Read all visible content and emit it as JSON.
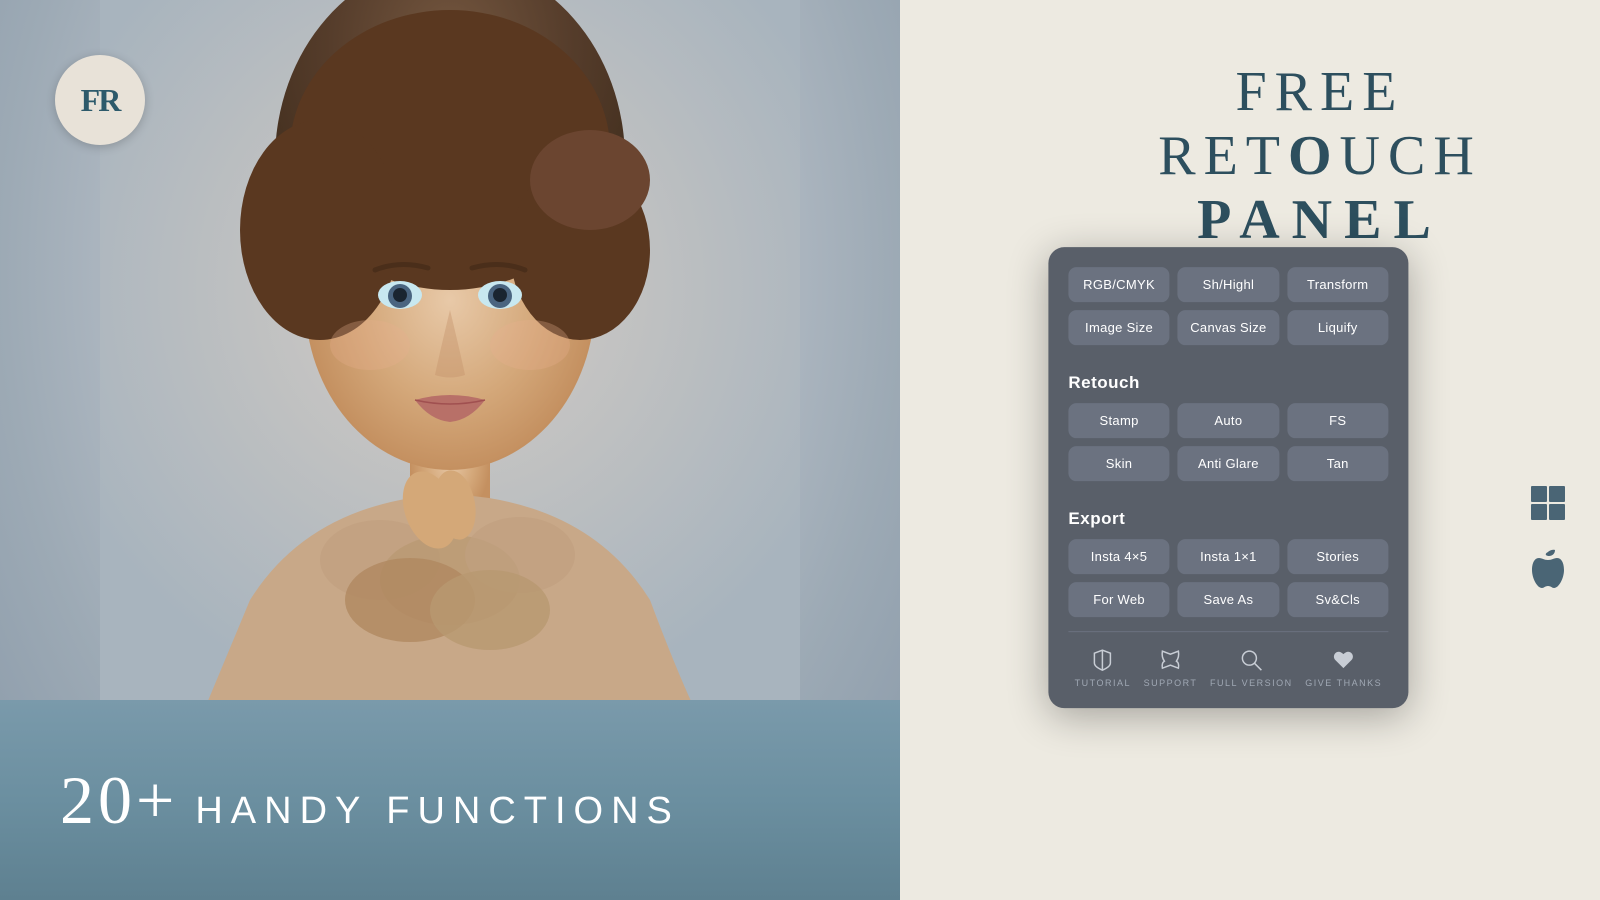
{
  "logo": {
    "text": "FR"
  },
  "hero": {
    "tagline_number": "20+",
    "tagline_text": "HANDY FUNCTIONS"
  },
  "title": {
    "line1_prefix": "FREE RET",
    "line1_bold": "O",
    "line1_suffix": "UCH",
    "line2": "PANEL"
  },
  "panel": {
    "top_buttons": [
      {
        "label": "RGB/CMYK"
      },
      {
        "label": "Sh/Highl"
      },
      {
        "label": "Transform"
      }
    ],
    "top_buttons2": [
      {
        "label": "Image Size"
      },
      {
        "label": "Canvas Size"
      },
      {
        "label": "Liquify"
      }
    ],
    "retouch_section": "Retouch",
    "retouch_buttons1": [
      {
        "label": "Stamp"
      },
      {
        "label": "Auto"
      },
      {
        "label": "FS"
      }
    ],
    "retouch_buttons2": [
      {
        "label": "Skin"
      },
      {
        "label": "Anti Glare"
      },
      {
        "label": "Tan"
      }
    ],
    "export_section": "Export",
    "export_buttons1": [
      {
        "label": "Insta 4×5"
      },
      {
        "label": "Insta 1×1"
      },
      {
        "label": "Stories"
      }
    ],
    "export_buttons2": [
      {
        "label": "For Web"
      },
      {
        "label": "Save As"
      },
      {
        "label": "Sv&Cls"
      }
    ],
    "toolbar": [
      {
        "icon": "✏️",
        "label": "TUTORIAL",
        "unicode": "✎"
      },
      {
        "icon": "🖌️",
        "label": "SUPPORT",
        "unicode": "✓"
      },
      {
        "icon": "🔍",
        "label": "FULL VERSION",
        "unicode": "⚲"
      },
      {
        "icon": "📋",
        "label": "GIVE THANKS",
        "unicode": "♥"
      }
    ]
  },
  "platforms": {
    "windows": "⊞",
    "apple": ""
  },
  "colors": {
    "panel_bg": "#595f69",
    "btn_bg": "#6b7280",
    "text_primary": "#2d4f5e",
    "accent": "#5e8090"
  }
}
